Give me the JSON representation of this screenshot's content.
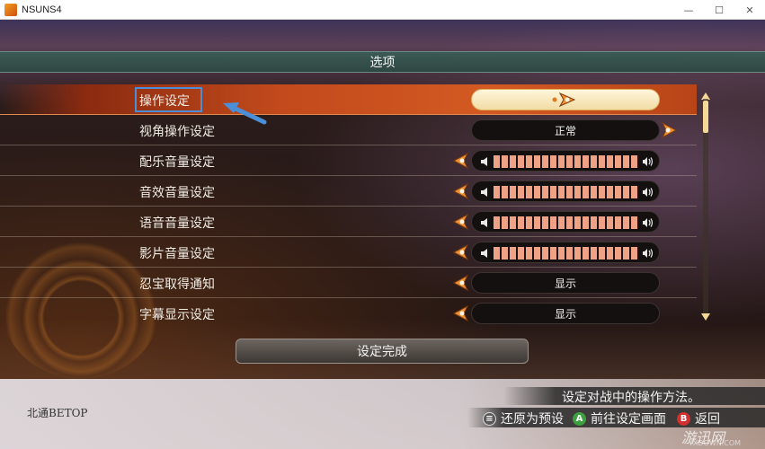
{
  "window": {
    "title": "NSUNS4",
    "minimize": "—",
    "maximize": "☐",
    "close": "✕"
  },
  "header": {
    "title": "选项"
  },
  "options": [
    {
      "label": "操作设定",
      "value": ""
    },
    {
      "label": "视角操作设定",
      "value": "正常"
    },
    {
      "label": "配乐音量设定",
      "volume": 1.0
    },
    {
      "label": "音效音量设定",
      "volume": 1.0
    },
    {
      "label": "语音音量设定",
      "volume": 1.0
    },
    {
      "label": "影片音量设定",
      "volume": 1.0
    },
    {
      "label": "忍宝取得通知",
      "value": "显示"
    },
    {
      "label": "字幕显示设定",
      "value": "显示"
    }
  ],
  "done_button": "设定完成",
  "footer": {
    "brand": "北通BETOP",
    "description": "设定对战中的操作方法。",
    "hints": [
      {
        "icon": "≡",
        "label": "还原为预设"
      },
      {
        "icon": "A",
        "label": "前往设定画面"
      },
      {
        "icon": "B",
        "label": "返回"
      }
    ],
    "watermark": "游迅网",
    "watermark_sub": "YXDOWN.COM"
  },
  "colors": {
    "selected_row": "#c24a1c",
    "header_bar": "#3c5a55",
    "volume_fill": "#f0a286",
    "accent_orange": "#f08a30",
    "highlight_box": "#4a8fd8"
  }
}
